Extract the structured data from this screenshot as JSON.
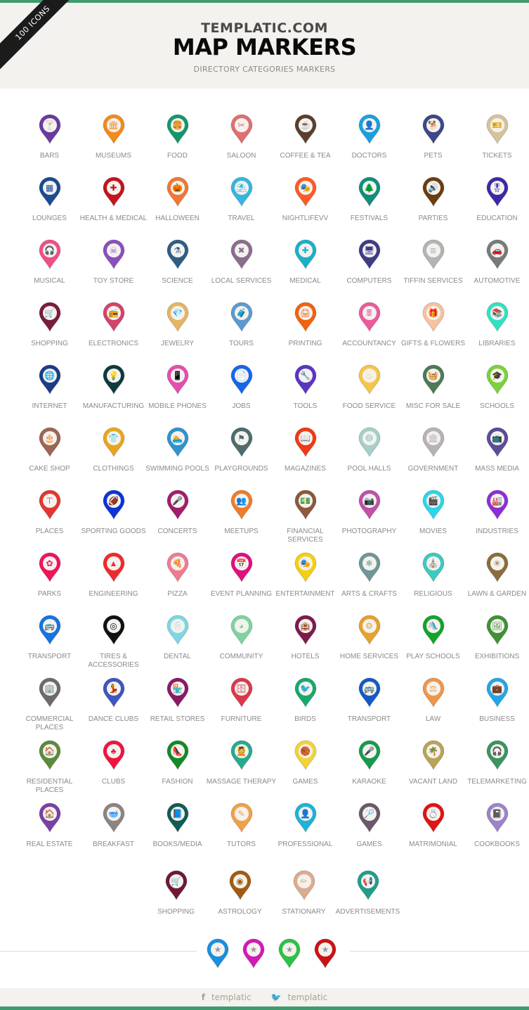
{
  "header": {
    "ribbon": "100 ICONS",
    "site_name": "TEMPLATIC.COM",
    "title": "MAP MARKERS",
    "subtitle": "DIRECTORY CATEGORIES MARKERS"
  },
  "markers": [
    [
      {
        "label": "BARS",
        "color": "#6a3aa2",
        "icon": "cocktail-icon",
        "glyph": "🍸"
      },
      {
        "label": "MUSEUMS",
        "color": "#f38a1b",
        "icon": "museum-icon",
        "glyph": "🏛"
      },
      {
        "label": "FOOD",
        "color": "#12976c",
        "icon": "burger-icon",
        "glyph": "🍔"
      },
      {
        "label": "SALOON",
        "color": "#e06f6f",
        "icon": "scissors-icon",
        "glyph": "✂"
      },
      {
        "label": "COFFEE & TEA",
        "color": "#5c3e2b",
        "icon": "coffee-icon",
        "glyph": "☕"
      },
      {
        "label": "DOCTORS",
        "color": "#1aa0e0",
        "icon": "doctor-icon",
        "glyph": "👤"
      },
      {
        "label": "PETS",
        "color": "#3c4889",
        "icon": "dog-icon",
        "glyph": "🐕"
      },
      {
        "label": "TICKETS",
        "color": "#d6c39a",
        "icon": "ticket-icon",
        "glyph": "🎫"
      }
    ],
    [
      {
        "label": "LOUNGES",
        "color": "#1b4b93",
        "icon": "building-icon",
        "glyph": "▦"
      },
      {
        "label": "HEALTH & MEDICAL",
        "color": "#c3151e",
        "icon": "first-aid-icon",
        "glyph": "✚"
      },
      {
        "label": "HALLOWEEN",
        "color": "#f07738",
        "icon": "pumpkin-icon",
        "glyph": "🎃"
      },
      {
        "label": "TRAVEL",
        "color": "#35b6df",
        "icon": "beach-icon",
        "glyph": "⛱"
      },
      {
        "label": "NIGHTLIFEVV",
        "color": "#ff5a26",
        "icon": "mask-icon",
        "glyph": "🎭"
      },
      {
        "label": "FESTIVALS",
        "color": "#0f8f7b",
        "icon": "tree-icon",
        "glyph": "🌲"
      },
      {
        "label": "PARTIES",
        "color": "#6b3d12",
        "icon": "speaker-icon",
        "glyph": "🔊"
      },
      {
        "label": "EDUCATION",
        "color": "#3a2aa6",
        "icon": "award-icon",
        "glyph": "🎖"
      }
    ],
    [
      {
        "label": "MUSICAL",
        "color": "#f04e86",
        "icon": "headphones-icon",
        "glyph": "🎧"
      },
      {
        "label": "TOY STORE",
        "color": "#8a4fc0",
        "icon": "skull-icon",
        "glyph": "☠"
      },
      {
        "label": "SCIENCE",
        "color": "#2f5e84",
        "icon": "flask-icon",
        "glyph": "⚗"
      },
      {
        "label": "LOCAL SERVICES",
        "color": "#8a6e8e",
        "icon": "tools-icon",
        "glyph": "✖"
      },
      {
        "label": "MEDICAL",
        "color": "#19b1c8",
        "icon": "plus-icon",
        "glyph": "✚"
      },
      {
        "label": "COMPUTERS",
        "color": "#3f3c86",
        "icon": "monitor-icon",
        "glyph": "🖥"
      },
      {
        "label": "TIFFIN SERVICES",
        "color": "#b4b4b4",
        "icon": "tiffin-icon",
        "glyph": "≣"
      },
      {
        "label": "AUTOMOTIVE",
        "color": "#767c79",
        "icon": "car-icon",
        "glyph": "🚗"
      }
    ],
    [
      {
        "label": "SHOPPING",
        "color": "#7a1d3a",
        "icon": "cart-icon",
        "glyph": "🛒"
      },
      {
        "label": "ELECTRONICS",
        "color": "#d24469",
        "icon": "electronics-icon",
        "glyph": "📻"
      },
      {
        "label": "JEWELRY",
        "color": "#e5b564",
        "icon": "diamond-icon",
        "glyph": "💎"
      },
      {
        "label": "TOURS",
        "color": "#5c9bd0",
        "icon": "luggage-icon",
        "glyph": "🧳"
      },
      {
        "label": "PRINTING",
        "color": "#f2630f",
        "icon": "printer-icon",
        "glyph": "🖨"
      },
      {
        "label": "ACCOUNTANCY",
        "color": "#ec5a9c",
        "icon": "calculator-icon",
        "glyph": "🖩"
      },
      {
        "label": "GIFTS & FLOWERS",
        "color": "#f6c2a0",
        "icon": "gift-icon",
        "glyph": "🎁"
      },
      {
        "label": "LIBRARIES",
        "color": "#30e2c2",
        "icon": "books-icon",
        "glyph": "📚"
      }
    ],
    [
      {
        "label": "INTERNET",
        "color": "#1d3b87",
        "icon": "globe-icon",
        "glyph": "🌐"
      },
      {
        "label": "MANUFACTURING",
        "color": "#0e3b3e",
        "icon": "lightbulb-icon",
        "glyph": "💡"
      },
      {
        "label": "MOBILE PHONES",
        "color": "#e34fb0",
        "icon": "phone-icon",
        "glyph": "📱"
      },
      {
        "label": "JOBS",
        "color": "#1667e8",
        "icon": "cv-icon",
        "glyph": "📄"
      },
      {
        "label": "TOOLS",
        "color": "#5a36c2",
        "icon": "wrench-icon",
        "glyph": "🔧"
      },
      {
        "label": "FOOD SERVICE",
        "color": "#f6c54a",
        "icon": "grill-icon",
        "glyph": "♨"
      },
      {
        "label": "MISC FOR SALE",
        "color": "#4e7a56",
        "icon": "basket-icon",
        "glyph": "🧺"
      },
      {
        "label": "SCHOOLS",
        "color": "#7ad23c",
        "icon": "graduation-cap-icon",
        "glyph": "🎓"
      }
    ],
    [
      {
        "label": "CAKE SHOP",
        "color": "#9b6657",
        "icon": "cake-icon",
        "glyph": "🎂"
      },
      {
        "label": "CLOTHINGS",
        "color": "#e8a51e",
        "icon": "shirt-icon",
        "glyph": "👕"
      },
      {
        "label": "SWIMMING POOLS",
        "color": "#2f93cf",
        "icon": "swimmer-icon",
        "glyph": "🏊"
      },
      {
        "label": "PLAYGROUNDS",
        "color": "#4f6b6e",
        "icon": "flag-icon",
        "glyph": "⚑"
      },
      {
        "label": "MAGAZINES",
        "color": "#ef3a14",
        "icon": "open-book-icon",
        "glyph": "📖"
      },
      {
        "label": "POOL HALLS",
        "color": "#a7cfca",
        "icon": "billiard-icon",
        "glyph": "➑"
      },
      {
        "label": "GOVERNMENT",
        "color": "#b9b1b6",
        "icon": "government-icon",
        "glyph": "🏛"
      },
      {
        "label": "MASS MEDIA",
        "color": "#5b4d99",
        "icon": "tv-icon",
        "glyph": "📺"
      }
    ],
    [
      {
        "label": "PLACES",
        "color": "#e3372e",
        "icon": "signpost-icon",
        "glyph": "⊤"
      },
      {
        "label": "SPORTING GOODS",
        "color": "#0c34d6",
        "icon": "football-icon",
        "glyph": "🏈"
      },
      {
        "label": "CONCERTS",
        "color": "#a11e6a",
        "icon": "microphone-icon",
        "glyph": "🎤"
      },
      {
        "label": "MEETUPS",
        "color": "#f07c2a",
        "icon": "group-icon",
        "glyph": "👥"
      },
      {
        "label": "FINANCIAL SERVICES",
        "color": "#8b5a3c",
        "icon": "money-icon",
        "glyph": "💵"
      },
      {
        "label": "PHOTOGRAPHY",
        "color": "#c150a8",
        "icon": "camera-icon",
        "glyph": "📷"
      },
      {
        "label": "MOVIES",
        "color": "#2ad6ea",
        "icon": "clapper-icon",
        "glyph": "🎬"
      },
      {
        "label": "INDUSTRIES",
        "color": "#8e2ed6",
        "icon": "factory-icon",
        "glyph": "🏭"
      }
    ],
    [
      {
        "label": "PARKS",
        "color": "#f0145a",
        "icon": "flower-icon",
        "glyph": "✿"
      },
      {
        "label": "ENGINEERING",
        "color": "#f02a2a",
        "icon": "cone-icon",
        "glyph": "▲"
      },
      {
        "label": "PIZZA",
        "color": "#ef7b92",
        "icon": "pizza-icon",
        "glyph": "🍕"
      },
      {
        "label": "EVENT PLANNING",
        "color": "#e0107e",
        "icon": "calendar-icon",
        "glyph": "📅"
      },
      {
        "label": "ENTERTAINMENT",
        "color": "#f6cf10",
        "icon": "theater-icon",
        "glyph": "🎭"
      },
      {
        "label": "ARTS & CRAFTS",
        "color": "#6f9797",
        "icon": "snowflake-icon",
        "glyph": "❄"
      },
      {
        "label": "RELIGIOUS",
        "color": "#3ec9c0",
        "icon": "church-icon",
        "glyph": "⛪"
      },
      {
        "label": "LAWN & GARDEN",
        "color": "#8a6d3c",
        "icon": "leaf-icon",
        "glyph": "✳"
      }
    ],
    [
      {
        "label": "TRANSPORT",
        "color": "#1673e0",
        "icon": "bus-icon",
        "glyph": "🚌"
      },
      {
        "label": "TIRES & ACCESSORIES",
        "color": "#111111",
        "icon": "tire-icon",
        "glyph": "◎"
      },
      {
        "label": "DENTAL",
        "color": "#7ed7e1",
        "icon": "tooth-icon",
        "glyph": "🦷"
      },
      {
        "label": "COMMUNITY",
        "color": "#7fd3a0",
        "icon": "community-icon",
        "glyph": "◕"
      },
      {
        "label": "HOTELS",
        "color": "#7d1b4e",
        "icon": "hotel-icon",
        "glyph": "🏨"
      },
      {
        "label": "HOME SERVICES",
        "color": "#e8a12a",
        "icon": "gear-icon",
        "glyph": "⚙"
      },
      {
        "label": "PLAY SCHOOLS",
        "color": "#13a32c",
        "icon": "swing-icon",
        "glyph": "🛝"
      },
      {
        "label": "EXHIBITIONS",
        "color": "#3f9133",
        "icon": "frame-icon",
        "glyph": "🖼"
      }
    ],
    [
      {
        "label": "COMMERCIAL PLACES",
        "color": "#6b6b6b",
        "icon": "office-icon",
        "glyph": "🏢"
      },
      {
        "label": "DANCE CLUBS",
        "color": "#3f56c0",
        "icon": "dancer-icon",
        "glyph": "💃"
      },
      {
        "label": "RETAIL STORES",
        "color": "#8a1a66",
        "icon": "store-icon",
        "glyph": "🏪"
      },
      {
        "label": "FURNITURE",
        "color": "#d93a4a",
        "icon": "cabinet-icon",
        "glyph": "🗄"
      },
      {
        "label": "BIRDS",
        "color": "#16a96e",
        "icon": "bird-icon",
        "glyph": "🐦"
      },
      {
        "label": "TRANSPORT",
        "color": "#1559c8",
        "icon": "bus-icon",
        "glyph": "🚌"
      },
      {
        "label": "LAW",
        "color": "#f0964a",
        "icon": "gavel-icon",
        "glyph": "⚖"
      },
      {
        "label": "BUSINESS",
        "color": "#23a6e8",
        "icon": "briefcase-icon",
        "glyph": "💼"
      }
    ],
    [
      {
        "label": "RESIDENTIAL PLACES",
        "color": "#5b8a3c",
        "icon": "house-icon",
        "glyph": "🏠"
      },
      {
        "label": "CLUBS",
        "color": "#f0143e",
        "icon": "clover-icon",
        "glyph": "♣"
      },
      {
        "label": "FASHION",
        "color": "#138a26",
        "icon": "heel-icon",
        "glyph": "👠"
      },
      {
        "label": "MASSAGE THERAPY",
        "color": "#27ab8e",
        "icon": "massage-icon",
        "glyph": "💆"
      },
      {
        "label": "GAMES",
        "color": "#f4d337",
        "icon": "basketball-icon",
        "glyph": "🏀"
      },
      {
        "label": "KARAOKE",
        "color": "#179a4f",
        "icon": "mic-stand-icon",
        "glyph": "🎤"
      },
      {
        "label": "VACANT LAND",
        "color": "#b7a45a",
        "icon": "palm-icon",
        "glyph": "🌴"
      },
      {
        "label": "TELEMARKETING",
        "color": "#3b9461",
        "icon": "headset-icon",
        "glyph": "🎧"
      }
    ],
    [
      {
        "label": "REAL ESTATE",
        "color": "#7a3fa8",
        "icon": "home-icon",
        "glyph": "🏠"
      },
      {
        "label": "BREAKFAST",
        "color": "#8c8480",
        "icon": "bowl-icon",
        "glyph": "🥣"
      },
      {
        "label": "BOOKS/MEDIA",
        "color": "#125b57",
        "icon": "book-icon",
        "glyph": "📘"
      },
      {
        "label": "TUTORS",
        "color": "#f1a04a",
        "icon": "tutor-icon",
        "glyph": "✎"
      },
      {
        "label": "PROFESSIONAL",
        "color": "#1eb2d6",
        "icon": "user-icon",
        "glyph": "👤"
      },
      {
        "label": "GAMES",
        "color": "#6b5868",
        "icon": "player-icon",
        "glyph": "🏸"
      },
      {
        "label": "MATRIMONIAL",
        "color": "#e01414",
        "icon": "ring-icon",
        "glyph": "💍"
      },
      {
        "label": "COOKBOOKS",
        "color": "#9c83c9",
        "icon": "cookbook-icon",
        "glyph": "📓"
      }
    ]
  ],
  "last_row": [
    {
      "label": "SHOPPING",
      "color": "#6e1a33",
      "icon": "cart-icon",
      "glyph": "🛒"
    },
    {
      "label": "ASTROLOGY",
      "color": "#a25c12",
      "icon": "astrology-icon",
      "glyph": "◉"
    },
    {
      "label": "STATIONARY",
      "color": "#dcac8e",
      "icon": "pencil-icon",
      "glyph": "✏"
    },
    {
      "label": "ADVERTISEMENTS",
      "color": "#1e9e8c",
      "icon": "megaphone-icon",
      "glyph": "📢"
    }
  ],
  "sample_pins": [
    {
      "color": "#1a8ee0",
      "icon": "star-icon",
      "glyph": "★"
    },
    {
      "color": "#d21ab6",
      "icon": "star-icon",
      "glyph": "★"
    },
    {
      "color": "#2cc246",
      "icon": "star-icon",
      "glyph": "★"
    },
    {
      "color": "#cc1212",
      "icon": "star-icon",
      "glyph": "★"
    }
  ],
  "footer": {
    "facebook_glyph": "f",
    "facebook_label": "templatic",
    "twitter_glyph": "🐦",
    "twitter_label": "templatic"
  }
}
